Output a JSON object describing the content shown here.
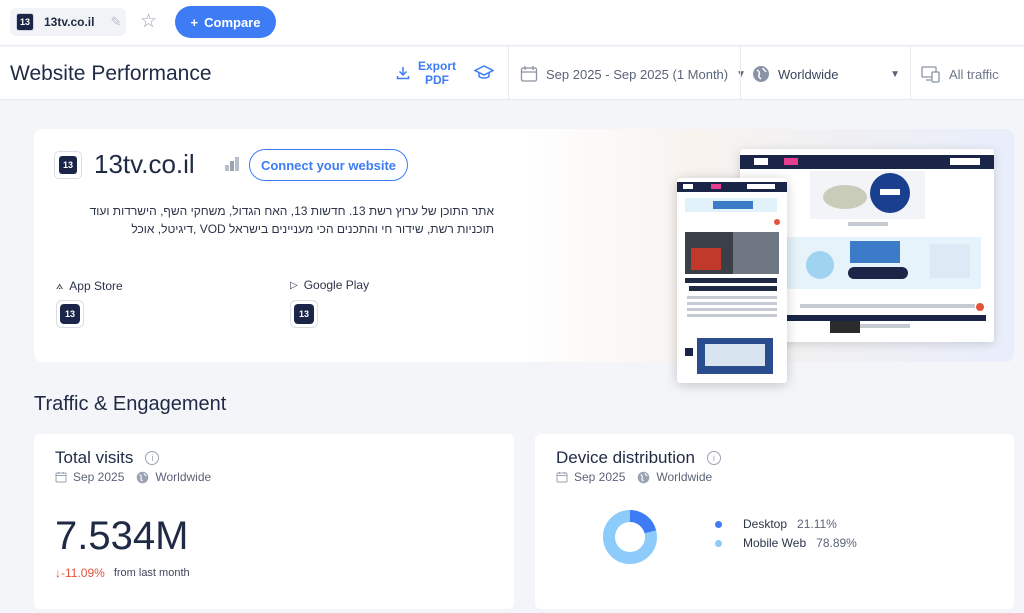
{
  "topbar": {
    "site_name": "13tv.co.il",
    "favicon_text": "13",
    "compare_label": "Compare"
  },
  "header": {
    "title": "Website Performance",
    "export_line1": "Export",
    "export_line2": "PDF",
    "date_range": "Sep 2025 - Sep 2025 (1 Month)",
    "geo": "Worldwide",
    "traffic": "All traffic"
  },
  "hero": {
    "site": "13tv.co.il",
    "connect_label": "Connect your website",
    "description": "אתר התוכן של ערוץ רשת 13. חדשות 13, האח הגדול, משחקי השף, הישרדות ועוד תוכניות רשת, שידור חי והתכנים הכי מעניינים בישראל VOD ,דיגיטל, אוכל",
    "app_store_label": "App Store",
    "google_play_label": "Google Play"
  },
  "section": {
    "title": "Traffic & Engagement"
  },
  "total_visits": {
    "title": "Total visits",
    "period": "Sep 2025",
    "geo": "Worldwide",
    "value": "7.534M",
    "change": "-11.09%",
    "change_note": "from last month"
  },
  "device": {
    "title": "Device distribution",
    "period": "Sep 2025",
    "geo": "Worldwide",
    "items": [
      {
        "label": "Desktop",
        "pct": "21.11%",
        "fraction": 0.2111,
        "color": "#3d7cf5"
      },
      {
        "label": "Mobile Web",
        "pct": "78.89%",
        "fraction": 0.7889,
        "color": "#8ccbfa"
      }
    ]
  },
  "colors": {
    "accent": "#3d7cf5",
    "negative": "#e5533c"
  }
}
